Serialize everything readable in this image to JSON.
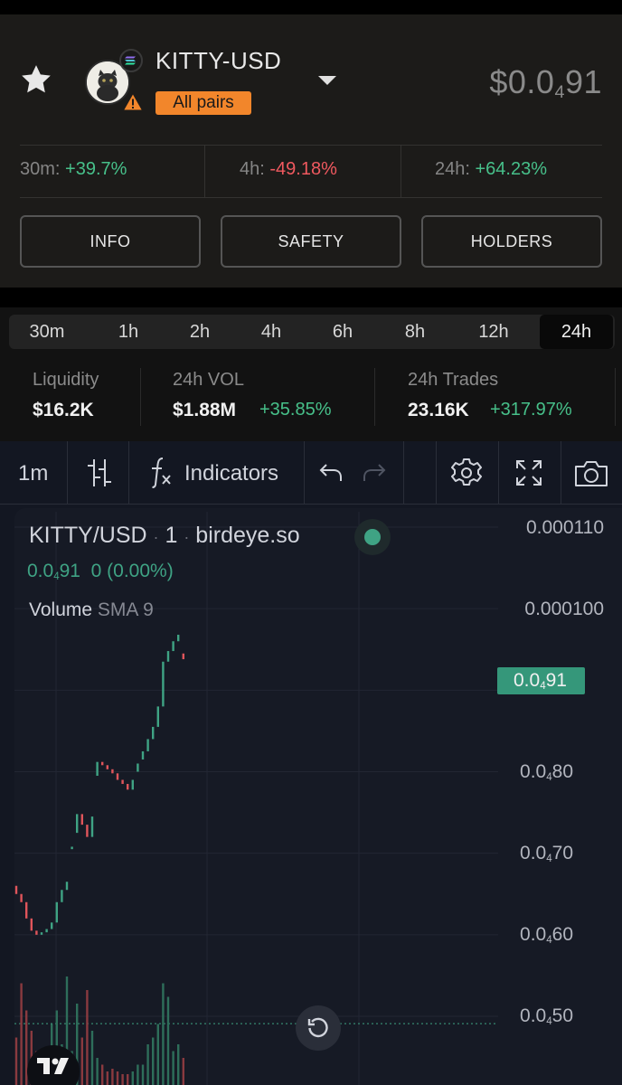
{
  "pair": {
    "name": "KITTY-USD",
    "pairs_badge": "All pairs",
    "price_prefix": "$0.0",
    "price_sub": "4",
    "price_suffix": "91"
  },
  "changes": [
    {
      "label": "30m:",
      "value": "+39.7%",
      "direction": "up"
    },
    {
      "label": "4h:",
      "value": "-49.18%",
      "direction": "down"
    },
    {
      "label": "24h:",
      "value": "+64.23%",
      "direction": "up"
    }
  ],
  "buttons": {
    "info": "INFO",
    "safety": "SAFETY",
    "holders": "HOLDERS"
  },
  "timeframes": {
    "items": [
      "30m",
      "1h",
      "2h",
      "4h",
      "6h",
      "8h",
      "12h",
      "24h"
    ],
    "selected": "24h"
  },
  "stats": {
    "liquidity": {
      "label": "Liquidity",
      "value": "$16.2K"
    },
    "volume": {
      "label": "24h VOL",
      "value": "$1.88M",
      "change": "+35.85%"
    },
    "trades": {
      "label": "24h Trades",
      "value": "23.16K",
      "change": "+317.97%"
    }
  },
  "toolbar": {
    "interval": "1m",
    "indicators": "Indicators"
  },
  "legend": {
    "symbol": "KITTY/USD",
    "sep1": "·",
    "interval": "1",
    "sep2": "·",
    "source": "birdeye.so",
    "ohlc_prefix": "0.0",
    "ohlc_sub": "4",
    "ohlc_suffix": "91",
    "ohlc_change": "0 (0.00%)",
    "volume_label": "Volume",
    "volume_indicator": "SMA 9"
  },
  "price_axis": [
    {
      "prefix": "0.000110",
      "sub": "",
      "suffix": ""
    },
    {
      "prefix": "0.000100",
      "sub": "",
      "suffix": ""
    },
    {
      "prefix": "0.0",
      "sub": "4",
      "suffix": "80"
    },
    {
      "prefix": "0.0",
      "sub": "4",
      "suffix": "70"
    },
    {
      "prefix": "0.0",
      "sub": "4",
      "suffix": "60"
    },
    {
      "prefix": "0.0",
      "sub": "4",
      "suffix": "50"
    }
  ],
  "last_price_tag": {
    "prefix": "0.0",
    "sub": "4",
    "suffix": "91"
  },
  "colors": {
    "up": "#47c08a",
    "down": "#f0595f",
    "badge": "#f2862b",
    "chart_bg": "#161a25",
    "candle_up": "#3fa384",
    "candle_down": "#e0555b"
  },
  "icons": [
    "star-icon",
    "token-avatar",
    "solana-badge-icon",
    "warning-icon",
    "caret-down-icon",
    "bar-style-icon",
    "fx-icon",
    "undo-icon",
    "redo-icon",
    "gear-icon",
    "fullscreen-icon",
    "camera-icon",
    "reset-icon",
    "tradingview-logo"
  ],
  "chart_data": {
    "type": "candlestick",
    "y_unit": "USD",
    "ylim": [
      4.5e-05,
      0.000113
    ],
    "last_price": 4.91e-05,
    "grid": true,
    "candles": [
      {
        "o": 6.6e-05,
        "c": 6.5e-05,
        "dir": "down",
        "vol": 0.35
      },
      {
        "o": 6.5e-05,
        "c": 6.4e-05,
        "dir": "down",
        "vol": 0.75
      },
      {
        "o": 6.4e-05,
        "c": 6.2e-05,
        "dir": "down",
        "vol": 0.55
      },
      {
        "o": 6.2e-05,
        "c": 6.05e-05,
        "dir": "down",
        "vol": 0.4
      },
      {
        "o": 6.05e-05,
        "c": 6e-05,
        "dir": "down",
        "vol": 0.25
      },
      {
        "o": 6e-05,
        "c": 6.03e-05,
        "dir": "up",
        "vol": 0.2
      },
      {
        "o": 6.03e-05,
        "c": 6.07e-05,
        "dir": "up",
        "vol": 0.15
      },
      {
        "o": 6.07e-05,
        "c": 6.15e-05,
        "dir": "up",
        "vol": 0.45
      },
      {
        "o": 6.15e-05,
        "c": 6.4e-05,
        "dir": "up",
        "vol": 0.55
      },
      {
        "o": 6.4e-05,
        "c": 6.55e-05,
        "dir": "up",
        "vol": 0.3
      },
      {
        "o": 6.55e-05,
        "c": 6.65e-05,
        "dir": "up",
        "vol": 0.8
      },
      {
        "o": 7.05e-05,
        "c": 7.08e-05,
        "dir": "up",
        "vol": 0.25
      },
      {
        "o": 7.25e-05,
        "c": 7.48e-05,
        "dir": "up",
        "vol": 0.6
      },
      {
        "o": 7.48e-05,
        "c": 7.35e-05,
        "dir": "down",
        "vol": 0.35
      },
      {
        "o": 7.35e-05,
        "c": 7.2e-05,
        "dir": "down",
        "vol": 0.7
      },
      {
        "o": 7.2e-05,
        "c": 7.45e-05,
        "dir": "up",
        "vol": 0.4
      },
      {
        "o": 7.95e-05,
        "c": 8.12e-05,
        "dir": "up",
        "vol": 0.2
      },
      {
        "o": 8.12e-05,
        "c": 8.08e-05,
        "dir": "down",
        "vol": 0.15
      },
      {
        "o": 8.08e-05,
        "c": 8.03e-05,
        "dir": "down",
        "vol": 0.1
      },
      {
        "o": 8.03e-05,
        "c": 7.98e-05,
        "dir": "down",
        "vol": 0.12
      },
      {
        "o": 7.98e-05,
        "c": 7.9e-05,
        "dir": "down",
        "vol": 0.1
      },
      {
        "o": 7.9e-05,
        "c": 7.85e-05,
        "dir": "down",
        "vol": 0.08
      },
      {
        "o": 7.85e-05,
        "c": 7.78e-05,
        "dir": "down",
        "vol": 0.08
      },
      {
        "o": 7.78e-05,
        "c": 7.9e-05,
        "dir": "up",
        "vol": 0.1
      },
      {
        "o": 8e-05,
        "c": 8.1e-05,
        "dir": "up",
        "vol": 0.15
      },
      {
        "o": 8.15e-05,
        "c": 8.25e-05,
        "dir": "up",
        "vol": 0.15
      },
      {
        "o": 8.25e-05,
        "c": 8.4e-05,
        "dir": "up",
        "vol": 0.3
      },
      {
        "o": 8.4e-05,
        "c": 8.55e-05,
        "dir": "up",
        "vol": 0.35
      },
      {
        "o": 8.55e-05,
        "c": 8.8e-05,
        "dir": "up",
        "vol": 0.45
      },
      {
        "o": 8.8e-05,
        "c": 9.35e-05,
        "dir": "up",
        "vol": 0.75
      },
      {
        "o": 9.35e-05,
        "c": 9.48e-05,
        "dir": "up",
        "vol": 0.65
      },
      {
        "o": 9.48e-05,
        "c": 9.6e-05,
        "dir": "up",
        "vol": 0.25
      },
      {
        "o": 9.6e-05,
        "c": 9.68e-05,
        "dir": "up",
        "vol": 0.3
      },
      {
        "o": 9.45e-05,
        "c": 9.38e-05,
        "dir": "down",
        "vol": 0.2
      }
    ]
  }
}
